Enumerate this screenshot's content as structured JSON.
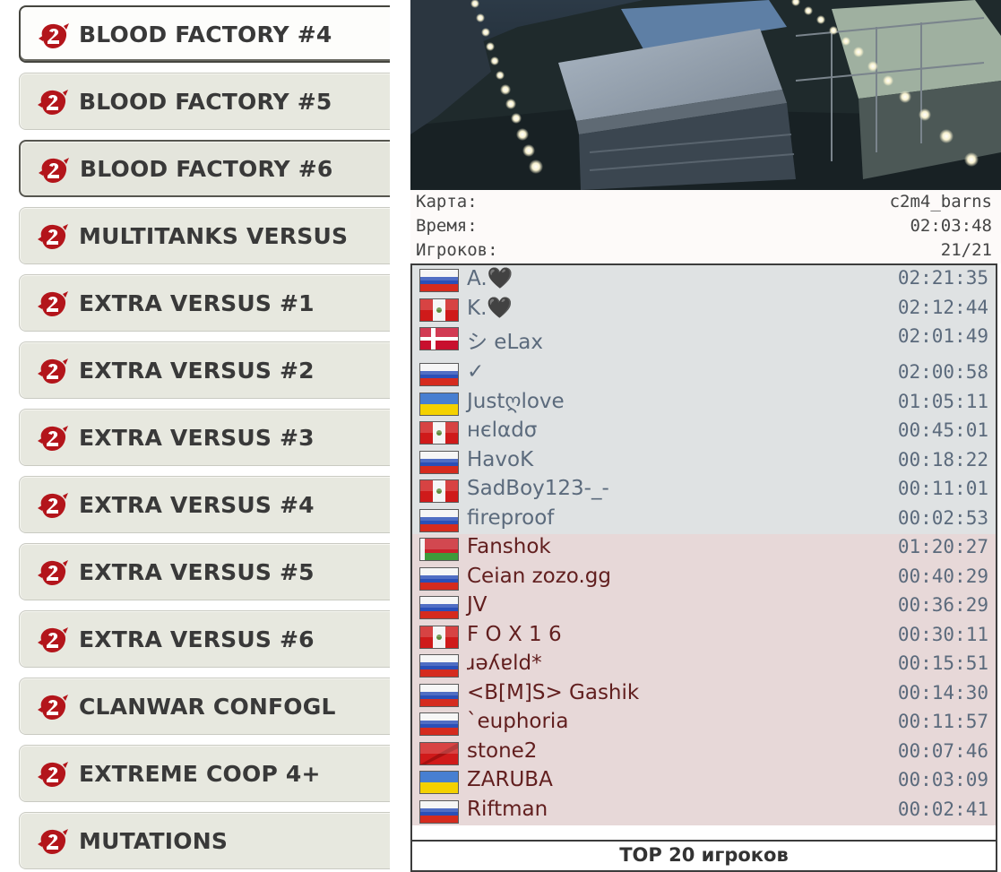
{
  "sidebar": {
    "servers": [
      {
        "label": "BLOOD FACTORY #4",
        "state": "active"
      },
      {
        "label": "BLOOD FACTORY #5",
        "state": "normal"
      },
      {
        "label": "BLOOD FACTORY #6",
        "state": "hover"
      },
      {
        "label": "MULTITANKS VERSUS",
        "state": "normal"
      },
      {
        "label": "EXTRA VERSUS #1",
        "state": "normal"
      },
      {
        "label": "EXTRA VERSUS #2",
        "state": "normal"
      },
      {
        "label": "EXTRA VERSUS #3",
        "state": "normal"
      },
      {
        "label": "EXTRA VERSUS #4",
        "state": "normal"
      },
      {
        "label": "EXTRA VERSUS #5",
        "state": "normal"
      },
      {
        "label": "EXTRA VERSUS #6",
        "state": "normal"
      },
      {
        "label": "CLANWAR CONFOGL",
        "state": "normal"
      },
      {
        "label": "EXTREME COOP 4+",
        "state": "normal"
      },
      {
        "label": "MUTATIONS",
        "state": "normal"
      }
    ],
    "icon": "left4dead2-logo-icon",
    "icon_color": "#b3151b"
  },
  "server_info": {
    "map_label": "Карта:",
    "map_value": "c2m4_barns",
    "time_label": "Время:",
    "time_value": "02:03:48",
    "players_label": "Игроков:",
    "players_value": "21/21"
  },
  "players": [
    {
      "name": "A.🖤",
      "time": "02:21:35",
      "flag": "ru",
      "team": 1
    },
    {
      "name": "K.🖤",
      "time": "02:12:44",
      "flag": "pe",
      "team": 1
    },
    {
      "name": "シ eLax",
      "time": "02:01:49",
      "flag": "dk",
      "team": 1
    },
    {
      "name": "✓",
      "time": "02:00:58",
      "flag": "ru",
      "team": 1
    },
    {
      "name": "Justღlove",
      "time": "01:05:11",
      "flag": "ua",
      "team": 1
    },
    {
      "name": "нєlαdσ",
      "time": "00:45:01",
      "flag": "pe",
      "team": 1
    },
    {
      "name": "HavoK",
      "time": "00:18:22",
      "flag": "ru",
      "team": 1
    },
    {
      "name": "SadBoy123-_-",
      "time": "00:11:01",
      "flag": "pe",
      "team": 1
    },
    {
      "name": "fireproof",
      "time": "00:02:53",
      "flag": "ru",
      "team": 1
    },
    {
      "name": "Fanshok",
      "time": "01:20:27",
      "flag": "by",
      "team": 2
    },
    {
      "name": "Ceian zozo.gg",
      "time": "00:40:29",
      "flag": "ru",
      "team": 2
    },
    {
      "name": "JV",
      "time": "00:36:29",
      "flag": "ru",
      "team": 2
    },
    {
      "name": "F O X 1 6",
      "time": "00:30:11",
      "flag": "pe",
      "team": 2
    },
    {
      "name": "ɹǝʎɐld*",
      "time": "00:15:51",
      "flag": "ru",
      "team": 2
    },
    {
      "name": "<B[M]S> Gashik",
      "time": "00:14:30",
      "flag": "ru",
      "team": 2
    },
    {
      "name": "`euphoria",
      "time": "00:11:57",
      "flag": "ru",
      "team": 2
    },
    {
      "name": "stone2",
      "time": "00:07:46",
      "flag": "red",
      "team": 2
    },
    {
      "name": "ZARUBA",
      "time": "00:03:09",
      "flag": "ua",
      "team": 2
    },
    {
      "name": "Riftman",
      "time": "00:02:41",
      "flag": "ru",
      "team": 2
    }
  ],
  "top_players_label": "TOP 20 игроков",
  "colors": {
    "team1_bg": "#dfe2e3",
    "team2_bg": "#e7d8d8",
    "team1_text": "#5b6a7c",
    "team2_text": "#611e1e",
    "tab_bg": "#e7e8df"
  }
}
